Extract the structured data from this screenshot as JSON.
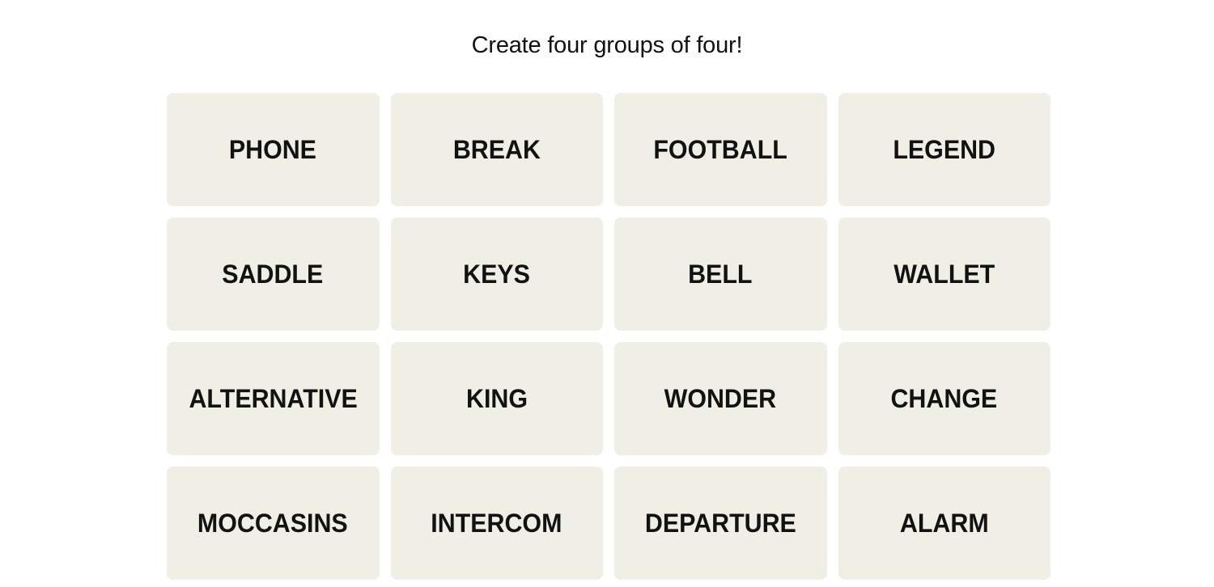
{
  "game": {
    "instructions": "Create four groups of four!",
    "colors": {
      "tile_background": "#efefe6",
      "tile_text": "#121212",
      "page_background": "#ffffff"
    },
    "tiles": [
      {
        "word": "PHONE",
        "selected": false
      },
      {
        "word": "BREAK",
        "selected": false
      },
      {
        "word": "FOOTBALL",
        "selected": false
      },
      {
        "word": "LEGEND",
        "selected": false
      },
      {
        "word": "SADDLE",
        "selected": false
      },
      {
        "word": "KEYS",
        "selected": false
      },
      {
        "word": "BELL",
        "selected": false
      },
      {
        "word": "WALLET",
        "selected": false
      },
      {
        "word": "ALTERNATIVE",
        "selected": false
      },
      {
        "word": "KING",
        "selected": false
      },
      {
        "word": "WONDER",
        "selected": false
      },
      {
        "word": "CHANGE",
        "selected": false
      },
      {
        "word": "MOCCASINS",
        "selected": false
      },
      {
        "word": "INTERCOM",
        "selected": false
      },
      {
        "word": "DEPARTURE",
        "selected": false
      },
      {
        "word": "ALARM",
        "selected": false
      }
    ]
  }
}
